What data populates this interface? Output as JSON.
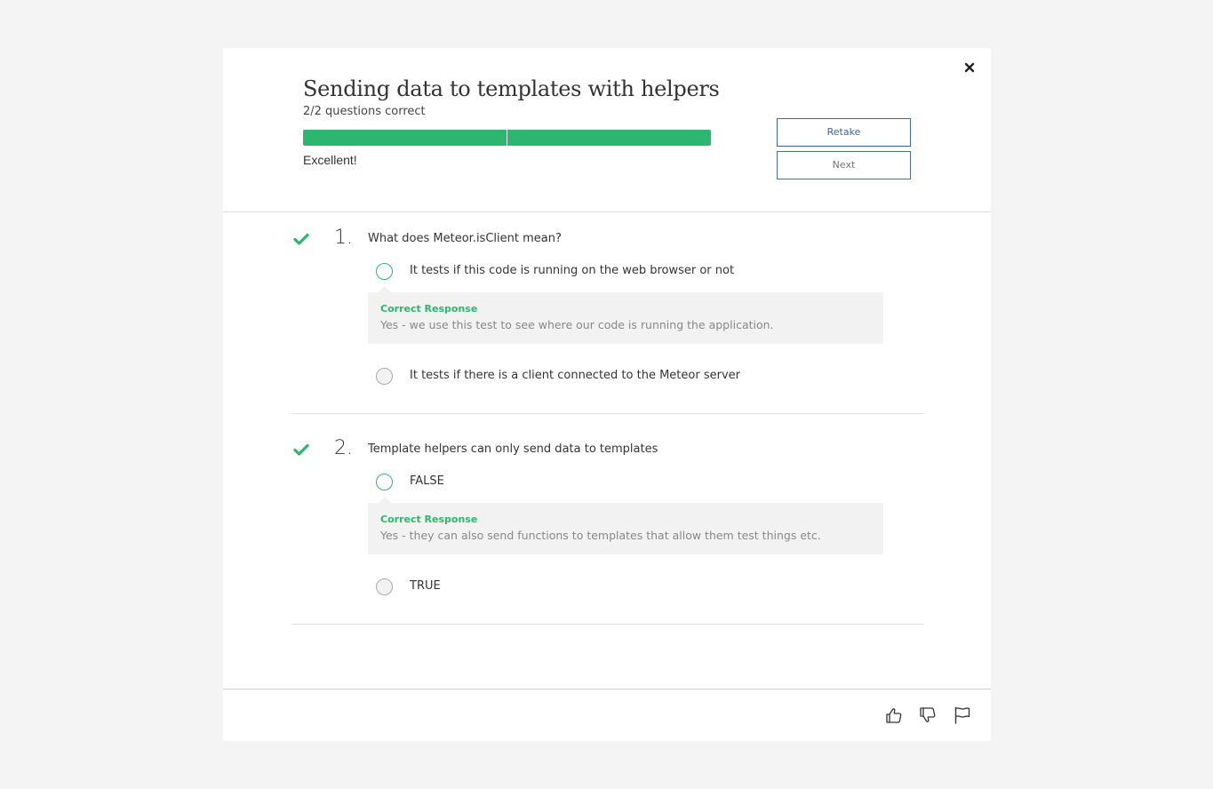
{
  "quiz": {
    "title": "Sending data to templates with helpers",
    "score_text": "2/2 questions correct",
    "segments_total": 2,
    "segments_correct": 2,
    "verdict": "Excellent!",
    "retake_label": "Retake",
    "next_label": "Next"
  },
  "questions": [
    {
      "number": "1.",
      "text": "What does Meteor.isClient mean?",
      "status": "correct",
      "options": [
        {
          "label": "It tests if this code is running on the web browser or not",
          "selected": true
        },
        {
          "label": "It tests if there is a client connected to the Meteor server",
          "selected": false
        }
      ],
      "feedback": {
        "title": "Correct Response",
        "text": "Yes - we use this test to see where our code is running the application."
      }
    },
    {
      "number": "2.",
      "text": "Template helpers can only send data to templates",
      "status": "correct",
      "options": [
        {
          "label": "FALSE",
          "selected": true
        },
        {
          "label": "TRUE",
          "selected": false
        }
      ],
      "feedback": {
        "title": "Correct Response",
        "text": "Yes - they can also send functions to templates that allow them test things etc."
      }
    }
  ],
  "icons": {
    "close": "close-icon",
    "check": "checkmark-icon",
    "thumbs_up": "thumbs-up-icon",
    "thumbs_down": "thumbs-down-icon",
    "flag": "flag-icon"
  },
  "colors": {
    "accent_green": "#2db66f",
    "button_blue": "#3e63a6",
    "background": "#f4f4f4",
    "feedback_bg": "#f2f2f2"
  }
}
